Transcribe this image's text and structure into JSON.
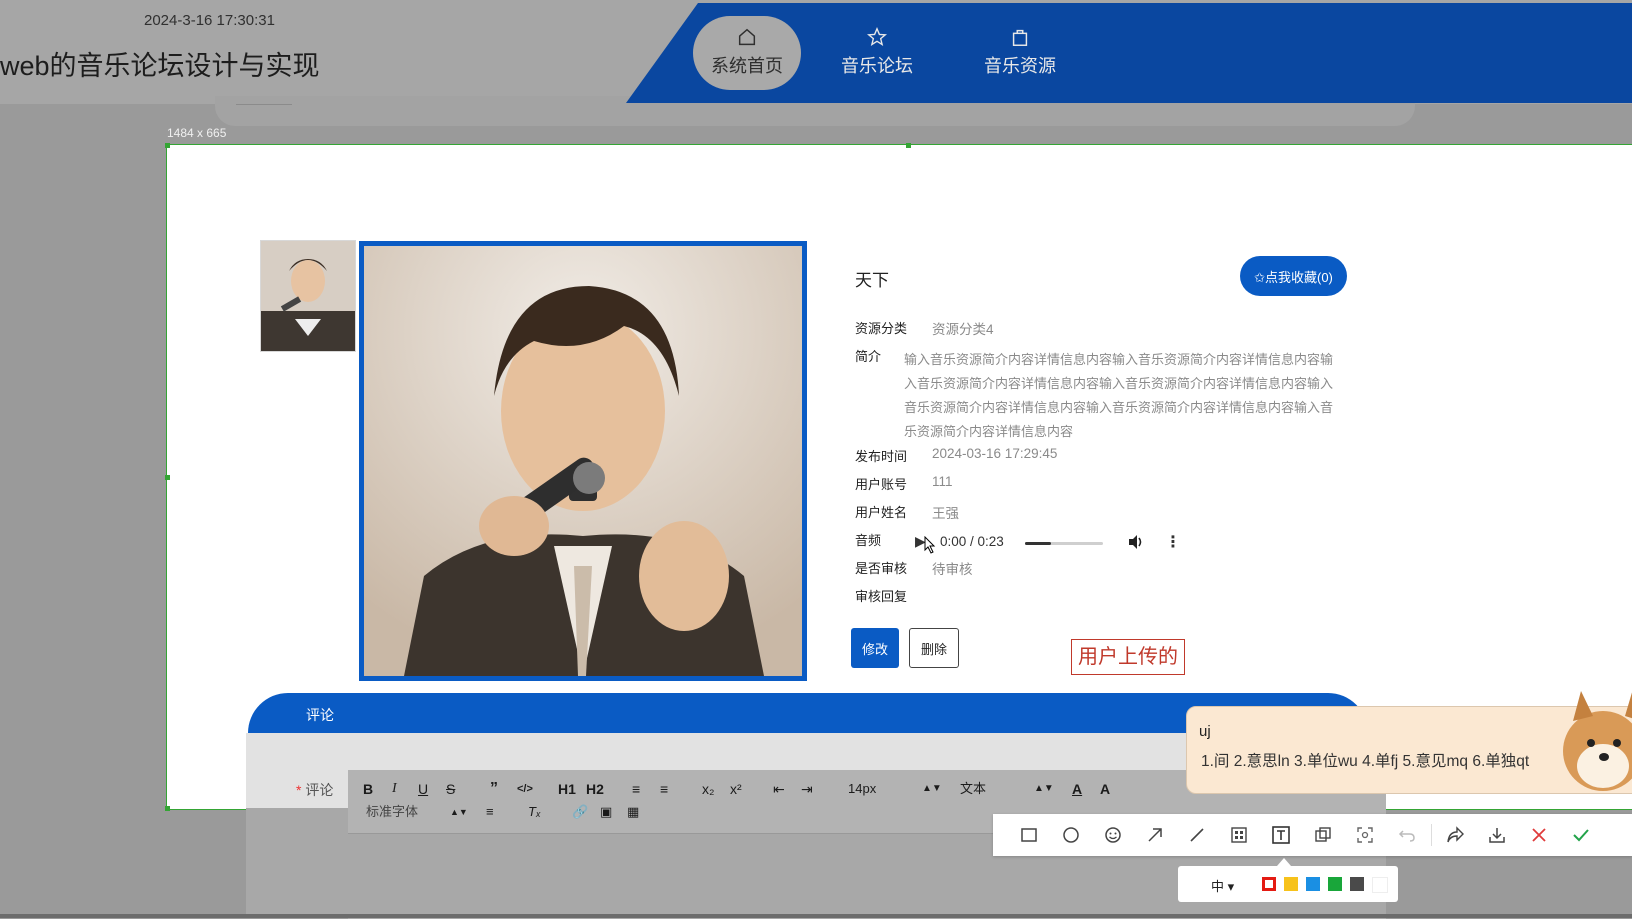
{
  "header": {
    "datetime": "2024-3-16 17:30:31",
    "site_title": "web的音乐论坛设计与实现",
    "nav": [
      {
        "label": "系统首页",
        "icon": "home-icon",
        "active": true
      },
      {
        "label": "音乐论坛",
        "icon": "star-icon",
        "active": false
      },
      {
        "label": "音乐资源",
        "icon": "bag-icon",
        "active": false
      }
    ]
  },
  "capture": {
    "size_label": "1484 x 665"
  },
  "detail": {
    "title": "天下",
    "favorite_button": "✩点我收藏(0)",
    "fields": {
      "category_label": "资源分类",
      "category_value": "资源分类4",
      "intro_label": "简介",
      "intro_value": "输入音乐资源简介内容详情信息内容输入音乐资源简介内容详情信息内容输入音乐资源简介内容详情信息内容输入音乐资源简介内容详情信息内容输入音乐资源简介内容详情信息内容输入音乐资源简介内容详情信息内容输入音乐资源简介内容详情信息内容",
      "publish_label": "发布时间",
      "publish_value": "2024-03-16 17:29:45",
      "account_label": "用户账号",
      "account_value": "111",
      "name_label": "用户姓名",
      "name_value": "王强",
      "audio_label": "音频",
      "audio_time": "0:00 / 0:23",
      "audio_progress": 0.33,
      "review_label": "是否审核",
      "review_value": "待审核",
      "reply_label": "审核回复",
      "reply_value": ""
    },
    "edit_button": "修改",
    "delete_button": "删除",
    "annotation_text": "用户上传的"
  },
  "comments": {
    "bar_title": "评论",
    "field_label": "评论",
    "toolbar": {
      "h1": "H1",
      "h2": "H2",
      "font_size": "14px",
      "block_type": "文本",
      "font_family": "标准字体"
    }
  },
  "ime": {
    "input": "uj",
    "candidates": "1.间  2.意思ln  3.单位wu  4.单fj  5.意见mq  6.单独qt"
  },
  "screenshot_tool": {
    "size_option": "中",
    "colors": [
      "#e41b13",
      "#f7c21b",
      "#1a8fe3",
      "#19a63a",
      "#4a4a4a",
      "#ffffff"
    ]
  }
}
